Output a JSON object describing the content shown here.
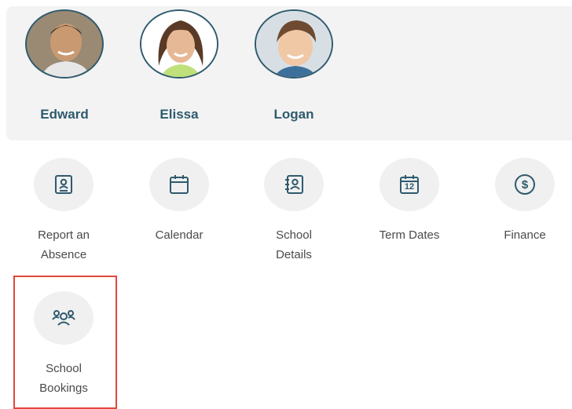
{
  "children": [
    {
      "name": "Edward"
    },
    {
      "name": "Elissa"
    },
    {
      "name": "Logan"
    }
  ],
  "tiles": [
    {
      "label": "Report an\nAbsence",
      "icon": "contact-card-icon"
    },
    {
      "label": "Calendar",
      "icon": "calendar-icon"
    },
    {
      "label": "School\nDetails",
      "icon": "address-book-icon"
    },
    {
      "label": "Term Dates",
      "icon": "calendar-date-icon",
      "icon_text": "12"
    },
    {
      "label": "Finance",
      "icon": "dollar-circle-icon",
      "icon_text": "$"
    },
    {
      "label": "School\nBookings",
      "icon": "group-icon"
    }
  ],
  "colors": {
    "accent": "#2f5a6e",
    "highlight": "#e2463c",
    "panel": "#f3f3f3"
  }
}
